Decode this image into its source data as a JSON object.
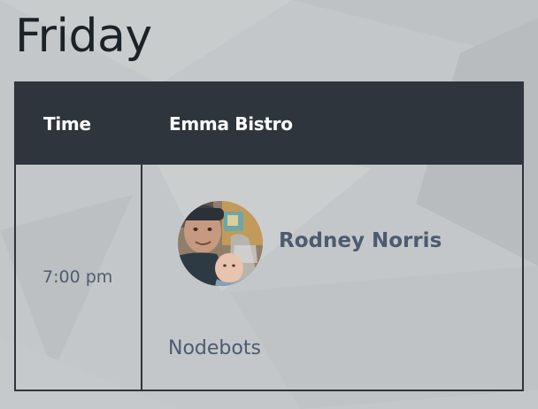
{
  "day": "Friday",
  "table": {
    "headers": {
      "time": "Time",
      "room": "Emma Bistro"
    },
    "rows": [
      {
        "time": "7:00 pm",
        "speaker": "Rodney Norris",
        "talk": "Nodebots"
      }
    ]
  },
  "colors": {
    "header_bg": "#2f353c",
    "accent_text": "#4c5b6f",
    "page_bg": "#c3c6c8"
  }
}
